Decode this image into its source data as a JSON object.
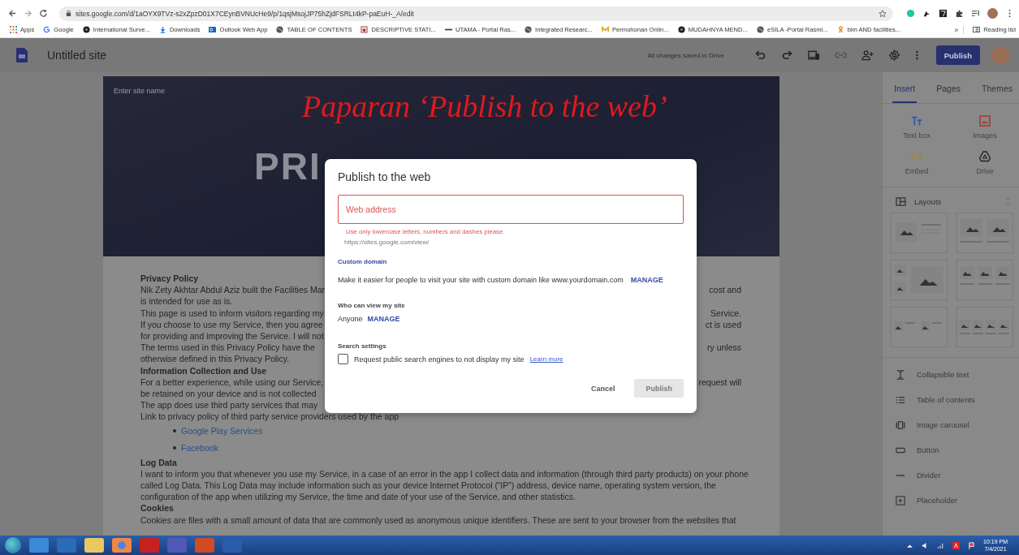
{
  "browser": {
    "address": "sites.google.com/d/1aOYX9TVz-s2xZpzD01X7CEynBVNUcHe9/p/1qsjMsojJP75hZjdFSRLt4kP-paEuH-_A/edit",
    "bookmarks": [
      {
        "label": "Apps",
        "kind": "apps"
      },
      {
        "label": "Google",
        "kind": "google"
      },
      {
        "label": "International Surve...",
        "kind": "dark"
      },
      {
        "label": "Downloads",
        "kind": "download"
      },
      {
        "label": "Outlook Web App",
        "kind": "outlook"
      },
      {
        "label": "TABLE OF CONTENTS",
        "kind": "globe"
      },
      {
        "label": "DESCRIPTIVE STATI...",
        "kind": "crest"
      },
      {
        "label": "UTAMA - Portal Ras...",
        "kind": "bar"
      },
      {
        "label": "Integrated Researc...",
        "kind": "globe"
      },
      {
        "label": "Permohonan Onlin...",
        "kind": "m"
      },
      {
        "label": "MUDAHNYA MEND...",
        "kind": "dark"
      },
      {
        "label": "eSILA -Portal Rasmi...",
        "kind": "globe"
      },
      {
        "label": "bim AND facilities...",
        "kind": "orange"
      }
    ],
    "overflow": "»",
    "reading_list": "Reading list"
  },
  "app": {
    "title": "Untitled site",
    "save_status": "All changes saved in Drive",
    "publish": "Publish"
  },
  "site": {
    "site_name_placeholder": "Enter site name",
    "heading": "PRI",
    "annotation": "Paparan ‘Publish to the web’",
    "body": [
      {
        "kind": "heading",
        "text": "Privacy Policy"
      },
      {
        "kind": "line",
        "left": "Nik Zety Akhtar Abdul Aziz built the Facilities Mar",
        "right": "cost and"
      },
      {
        "kind": "line",
        "left": "is intended for use as is."
      },
      {
        "kind": "line",
        "left": "This page is used to inform visitors regarding my",
        "right": "Service."
      },
      {
        "kind": "line",
        "left": "If you choose to use my Service, then you agree",
        "right": "ct is used"
      },
      {
        "kind": "line",
        "left": "for providing and improving the Service. I will not"
      },
      {
        "kind": "line",
        "left": "The terms used in this Privacy Policy have the",
        "right": "ry unless"
      },
      {
        "kind": "line",
        "left": "otherwise defined in this Privacy Policy."
      },
      {
        "kind": "heading",
        "text": "Information Collection and Use"
      },
      {
        "kind": "line",
        "left": "For a better experience, while using our Service,",
        "right": "request will"
      },
      {
        "kind": "line",
        "left": "be retained on your device and is not collected"
      },
      {
        "kind": "line",
        "left": "The app does use third party services that may"
      },
      {
        "kind": "line",
        "left": "Link to privacy policy of third party service providers used by the app"
      },
      {
        "kind": "bullet",
        "text": "Google Play Services"
      },
      {
        "kind": "bullet",
        "text": "Facebook"
      },
      {
        "kind": "heading",
        "text": "Log Data"
      },
      {
        "kind": "line",
        "left": "I want to inform you that whenever you use my Service, in a case of an error in the app I collect data and information (through third party products) on your phone"
      },
      {
        "kind": "line",
        "left": "called Log Data. This Log Data may include information such as your device Internet Protocol (“IP”) address, device name, operating system version, the"
      },
      {
        "kind": "line",
        "left": "configuration of the app when utilizing my Service, the time and date of your use of the Service, and other statistics."
      },
      {
        "kind": "heading",
        "text": "Cookies"
      },
      {
        "kind": "line",
        "left": "Cookies are files with a small amount of data that are commonly used as anonymous unique identifiers. These are sent to your browser from the websites that"
      }
    ]
  },
  "dialog": {
    "title": "Publish to the web",
    "field": {
      "placeholder": "Web address",
      "invalid": true
    },
    "error": "Use only lowercase letters, numbers and dashes please.",
    "url_prefix": "https://sites.google.com/view/",
    "custom_domain": {
      "label": "Custom domain",
      "text": "Make it easier for people to visit your site with custom domain like www.yourdomain.com",
      "action": "MANAGE"
    },
    "viewers": {
      "label": "Who can view my site",
      "value": "Anyone",
      "action": "MANAGE"
    },
    "search": {
      "label": "Search settings",
      "checkbox": {
        "label": "Request public search engines to not display my site",
        "checked": false
      },
      "link": "Learn more"
    },
    "buttons": [
      {
        "label": "Cancel",
        "kind": "text",
        "disabled": false
      },
      {
        "label": "Publish",
        "kind": "filled",
        "disabled": true
      }
    ]
  },
  "sidebar": {
    "tabs": [
      {
        "label": "Insert",
        "selected": true
      },
      {
        "label": "Pages",
        "selected": false
      },
      {
        "label": "Themes",
        "selected": false
      }
    ],
    "tools": [
      {
        "label": "Text box",
        "kind": "textbox"
      },
      {
        "label": "Images",
        "kind": "images"
      },
      {
        "label": "Embed",
        "kind": "embed"
      },
      {
        "label": "Drive",
        "kind": "drive"
      }
    ],
    "layouts_label": "Layouts",
    "items": [
      {
        "label": "Collapsible text",
        "kind": "collapsible"
      },
      {
        "label": "Table of contents",
        "kind": "toc"
      },
      {
        "label": "Image carousel",
        "kind": "carousel"
      },
      {
        "label": "Button",
        "kind": "button"
      },
      {
        "label": "Divider",
        "kind": "divider"
      },
      {
        "label": "Placeholder",
        "kind": "placeholder"
      }
    ]
  },
  "taskbar": {
    "time": "10:19 PM",
    "date": "7/4/2021"
  }
}
